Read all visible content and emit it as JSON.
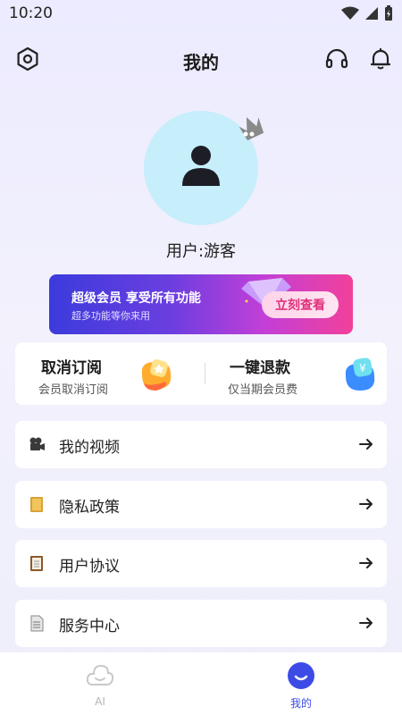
{
  "status_bar": {
    "time": "10:20"
  },
  "header": {
    "title": "我的",
    "settings_icon": "settings-hex-icon",
    "support_icon": "headset-icon",
    "notify_icon": "bell-icon"
  },
  "profile": {
    "username": "用户:游客",
    "avatar_icon": "user-icon",
    "badge_icon": "crown-icon"
  },
  "vip_banner": {
    "title": "超级会员 享受所有功能",
    "subtitle": "超多功能等你来用",
    "button_label": "立刻查看",
    "colors": {
      "start": "#3c3bdc",
      "end": "#f2409a"
    }
  },
  "actions": [
    {
      "title": "取消订阅",
      "subtitle": "会员取消订阅",
      "icon": "star-badge-icon"
    },
    {
      "title": "一键退款",
      "subtitle": "仅当期会员费",
      "icon": "yen-badge-icon"
    }
  ],
  "menu": [
    {
      "label": "我的视频",
      "icon": "video-camera-icon"
    },
    {
      "label": "隐私政策",
      "icon": "folder-icon"
    },
    {
      "label": "用户协议",
      "icon": "clipboard-icon"
    },
    {
      "label": "服务中心",
      "icon": "document-icon"
    }
  ],
  "bottom_nav": [
    {
      "label": "AI",
      "active": false
    },
    {
      "label": "我的",
      "active": true
    }
  ],
  "colors": {
    "accent": "#3d4be6",
    "avatar_bg": "#c6eefb"
  }
}
